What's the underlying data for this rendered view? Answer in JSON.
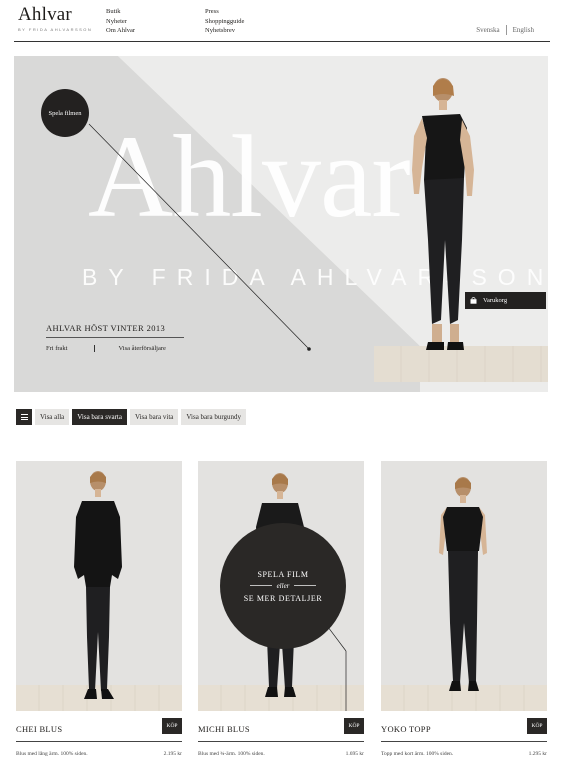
{
  "brand": {
    "name": "Ahlvar",
    "tagline": "BY FRIDA AHLVARSSON"
  },
  "nav": {
    "col1": [
      "Butik",
      "Nyheter",
      "Om Ahlvar"
    ],
    "col2": [
      "Press",
      "Shoppingguide",
      "Nyhetsbrev"
    ]
  },
  "languages": [
    "Svenska",
    "English"
  ],
  "hero": {
    "big_text": "Ahlvar",
    "sub_text": "BY FRIDA AHLVARSSON",
    "play_label": "Spela filmen",
    "collection_title": "AHLVAR HÖST VINTER 2013",
    "links": [
      "Fri frakt",
      "Visa återförsäljare"
    ],
    "cart_label": "Varukorg"
  },
  "filters": [
    "Visa alla",
    "Visa bara svarta",
    "Visa bara vita",
    "Visa bara burgundy"
  ],
  "active_filter": "Visa bara svarta",
  "products": [
    {
      "name": "CHEI BLUS",
      "buy": "KÖP",
      "desc": "Blus med lång ärm. 100% siden.",
      "price": "2.195 kr"
    },
    {
      "name": "MICHI BLUS",
      "buy": "KÖP",
      "desc": "Blus med ¾-ärm. 100% siden.",
      "price": "1.695 kr",
      "overlay": {
        "line1": "SPELA FILM",
        "line2": "eller",
        "line3": "SE MER DETALJER"
      }
    },
    {
      "name": "YOKO TOPP",
      "buy": "KÖP",
      "desc": "Topp med kort ärm. 100% siden.",
      "price": "1.295 kr"
    }
  ],
  "colors": {
    "dark": "#2a2826",
    "hero_bg": "#ececeb",
    "card_bg": "#e3e2e0",
    "floor": "#e4ddd1"
  },
  "icons": [
    "menu-icon",
    "bag-icon"
  ]
}
